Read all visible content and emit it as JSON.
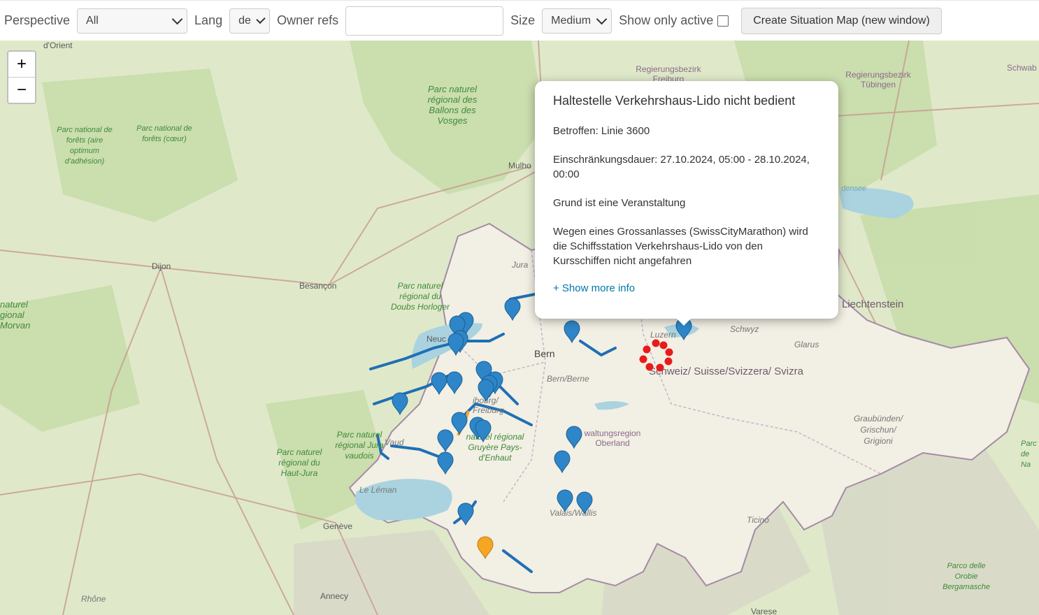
{
  "toolbar": {
    "perspective_label": "Perspective",
    "perspective_value": "All",
    "lang_label": "Lang",
    "lang_value": "de",
    "owner_refs_label": "Owner refs",
    "owner_refs_value": "",
    "size_label": "Size",
    "size_value": "Medium",
    "show_only_active_label": "Show only active",
    "show_only_active_checked": false,
    "create_button_label": "Create Situation Map (new window)"
  },
  "map": {
    "zoom_in_label": "+",
    "zoom_out_label": "−",
    "colors": {
      "background": "#dfe9c9",
      "switzerland": "#f2efe4",
      "lakes": "#aad3df",
      "marker_blue": "#2e86c8",
      "marker_orange": "#f5a623",
      "closure_red": "#e81b1b",
      "route_blue": "#1f6fb5"
    },
    "labels": {
      "dorient": "d'Orient",
      "parc_ballons": "Parc naturel régional des Ballons des Vosges",
      "parc_forets": "Parc national de forêts (aire optimum d'adhésion)",
      "parc_forets_coeur": "Parc national de forêts (cœur)",
      "mulhouse": "Mulho",
      "dijon": "Dijon",
      "besancon": "Besançon",
      "parc_doubs": "Parc naturel régional du Doubs Horloger",
      "morvan": "naturel gional Morvan",
      "jura": "Jura",
      "neuchatel": "Neuc",
      "bern": "Bern",
      "bern_berne": "Bern/Berne",
      "fribourg": "ibourg/ Freiburg",
      "parc_jura_vaudois": "Parc naturel régional Jura vaudois",
      "vaud": "Vaud",
      "parc_haut_jura": "Parc naturel régional du Haut-Jura",
      "le_leman": "Le Léman",
      "geneve": "Genève",
      "annecy": "Annecy",
      "rhone": "Rhône",
      "parc_gruyere": "naturel régional Gruyère Pays-d'Enhaut",
      "oberland": "waltungsregion Oberland",
      "valais": "Valais/Wallis",
      "luzern": "Luzern",
      "schwyz": "Schwyz",
      "glarus": "Glarus",
      "switzerland": "Schweiz/ Suisse/Svizzera/ Svizra",
      "liechtenstein": "Liechtenstein",
      "bodensee": "densee",
      "regbez_freiburg": "Regierungsbezirk Freiburg",
      "regbez_tubingen": "Regierungsbezirk Tübingen",
      "schwab": "Schwab",
      "graubunden": "Graubünden/ Grischun/ Grigioni",
      "ticino": "Ticino",
      "orobie": "Parco delle Orobie Bergamasche",
      "varese": "Varese",
      "parc_right": "Parc de Na"
    }
  },
  "popup": {
    "title": "Haltestelle Verkehrshaus-Lido nicht bedient",
    "affected": "Betroffen: Linie 3600",
    "duration": "Einschränkungsdauer: 27.10.2024, 05:00 - 28.10.2024, 00:00",
    "reason": "Grund ist eine Veranstaltung",
    "description": "Wegen eines Grossanlasses (SwissCityMarathon) wird die Schiffsstation Verkehrshaus-Lido von den Kursschiffen nicht angefahren",
    "more_link": "+ Show more info"
  }
}
